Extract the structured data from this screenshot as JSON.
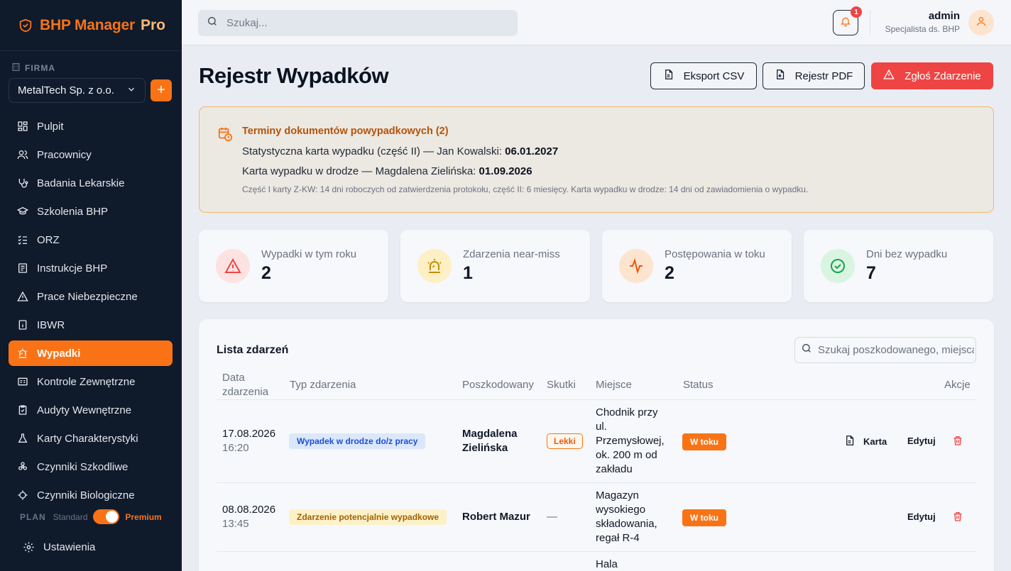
{
  "brand": {
    "name": "BHP Manager",
    "pro": "Pro"
  },
  "firma": {
    "label": "FIRMA",
    "selected": "MetalTech Sp. z o.o.",
    "add": "+"
  },
  "nav": [
    {
      "label": "Pulpit",
      "icon": "dashboard-icon"
    },
    {
      "label": "Pracownicy",
      "icon": "users-icon"
    },
    {
      "label": "Badania Lekarskie",
      "icon": "stethoscope-icon"
    },
    {
      "label": "Szkolenia BHP",
      "icon": "graduation-cap-icon"
    },
    {
      "label": "ORZ",
      "icon": "list-check-icon"
    },
    {
      "label": "Instrukcje BHP",
      "icon": "instructions-icon"
    },
    {
      "label": "Prace Niebezpieczne",
      "icon": "warning-icon"
    },
    {
      "label": "IBWR",
      "icon": "document-icon"
    },
    {
      "label": "Wypadki",
      "icon": "siren-icon",
      "active": true
    },
    {
      "label": "Kontrole Zewnętrzne",
      "icon": "id-card-icon"
    },
    {
      "label": "Audyty Wewnętrzne",
      "icon": "clipboard-icon"
    },
    {
      "label": "Karty Charakterystyki",
      "icon": "flask-icon"
    },
    {
      "label": "Czynniki Szkodliwe",
      "icon": "biohazard-icon"
    },
    {
      "label": "Czynniki Biologiczne",
      "icon": "microbe-icon"
    }
  ],
  "plan": {
    "label": "PLAN",
    "standard": "Standard",
    "premium": "Premium",
    "premium_on": true
  },
  "settings": {
    "label": "Ustawienia"
  },
  "topbar": {
    "search_placeholder": "Szukaj...",
    "notifications": "1",
    "user_name": "admin",
    "user_role": "Specjalista ds. BHP"
  },
  "header": {
    "title": "Rejestr Wypadków",
    "export_csv": "Eksport CSV",
    "registry_pdf": "Rejestr PDF",
    "report": "Zgłoś Zdarzenie"
  },
  "alert": {
    "title": "Terminy dokumentów powypadkowych (2)",
    "line1_text": "Statystyczna karta wypadku (część II) — Jan Kowalski: ",
    "line1_date": "06.01.2027",
    "line2_text": "Karta wypadku w drodze — Magdalena Zielińska: ",
    "line2_date": "01.09.2026",
    "note": "Część I karty Z-KW: 14 dni roboczych od zatwierdzenia protokołu, część II: 6 miesięcy. Karta wypadku w drodze: 14 dni od zawiadomienia o wypadku."
  },
  "stats": [
    {
      "label": "Wypadki w tym roku",
      "value": "2",
      "color": "#ef4444",
      "bg": "#fde2e2"
    },
    {
      "label": "Zdarzenia near-miss",
      "value": "1",
      "color": "#ca8a04",
      "bg": "#fdf0c4"
    },
    {
      "label": "Postępowania w toku",
      "value": "2",
      "color": "#ea580c",
      "bg": "#fde4cf"
    },
    {
      "label": "Dni bez wypadku",
      "value": "7",
      "color": "#16a34a",
      "bg": "#d9f5e2"
    }
  ],
  "events": {
    "title": "Lista zdarzeń",
    "search_placeholder": "Szukaj poszkodowanego, miejsca",
    "columns": {
      "date_line1": "Data",
      "date_line2": "zdarzenia",
      "type": "Typ zdarzenia",
      "victim": "Poszkodowany",
      "effects": "Skutki",
      "place": "Miejsce",
      "status": "Status",
      "actions": "Akcje"
    },
    "rows": [
      {
        "date": "17.08.2026",
        "time": "16:20",
        "type": "Wypadek w drodze do/z pracy",
        "victim_first": "Magdalena",
        "victim_last": "Zielińska",
        "effects": "Lekki",
        "place": [
          "Chodnik przy",
          "ul.",
          "Przemysłowej,",
          "ok. 200 m od",
          "zakładu"
        ],
        "status": "W toku",
        "card": "Karta",
        "edit": "Edytuj"
      },
      {
        "date": "08.08.2026",
        "time": "13:45",
        "type": "Zdarzenie potencjalnie wypadkowe",
        "victim": "Robert Mazur",
        "effects": "—",
        "place": [
          "Magazyn",
          "wysokiego",
          "składowania,",
          "regał R-4"
        ],
        "status": "W toku",
        "edit": "Edytuj"
      },
      {
        "place": [
          "Hala"
        ]
      }
    ]
  }
}
